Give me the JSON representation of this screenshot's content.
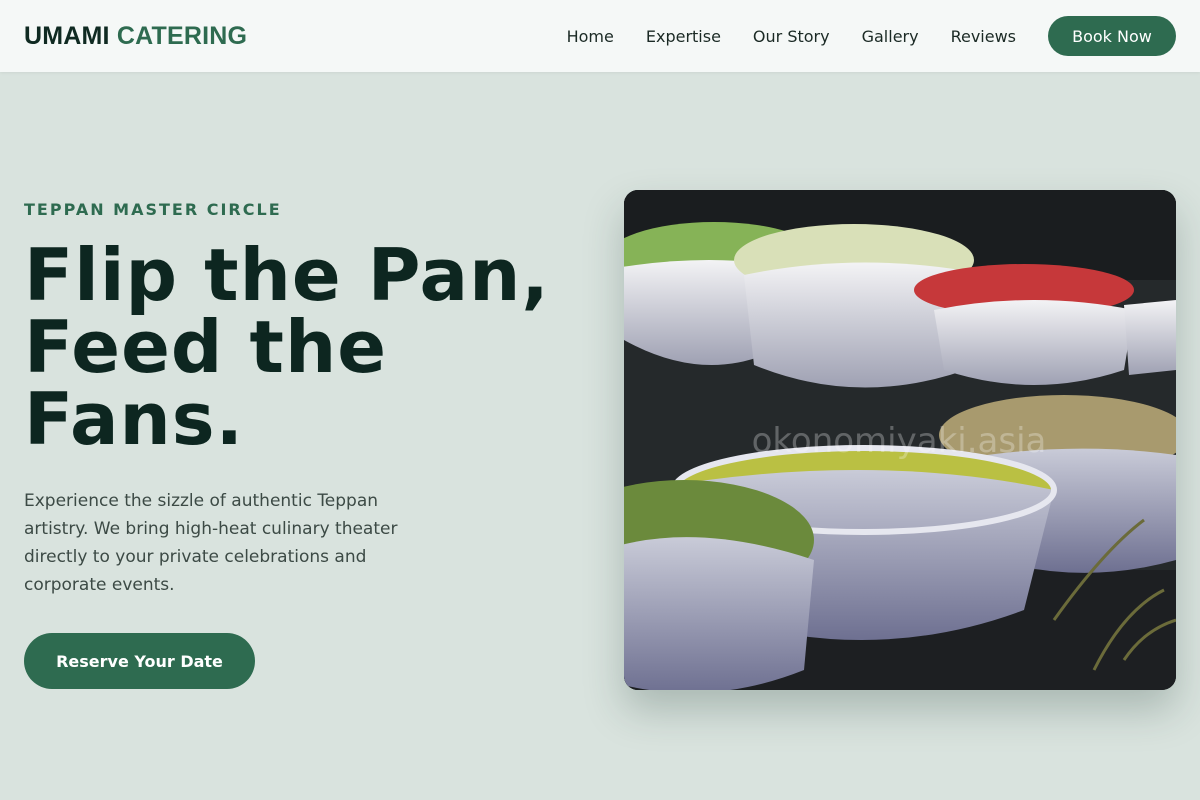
{
  "brand": {
    "name_main": "UMAMI",
    "name_accent": "CATERING"
  },
  "nav": {
    "links": [
      "Home",
      "Expertise",
      "Our Story",
      "Gallery",
      "Reviews"
    ],
    "cta_label": "Book Now"
  },
  "hero": {
    "eyebrow": "TEPPAN MASTER CIRCLE",
    "headline": "Flip the Pan,\nFeed the\nFans.",
    "description": "Experience the sizzle of authentic Teppan artistry. We bring high-heat culinary theater directly to your private celebrations and corporate events.",
    "cta_label": "Reserve Your Date",
    "image_watermark": "okonomiyaki.asia"
  },
  "colors": {
    "background": "#d9e3de",
    "navbar": "#f5f8f7",
    "accent": "#2e6b50",
    "heading": "#0d2620",
    "body_text": "#3c4a45"
  }
}
